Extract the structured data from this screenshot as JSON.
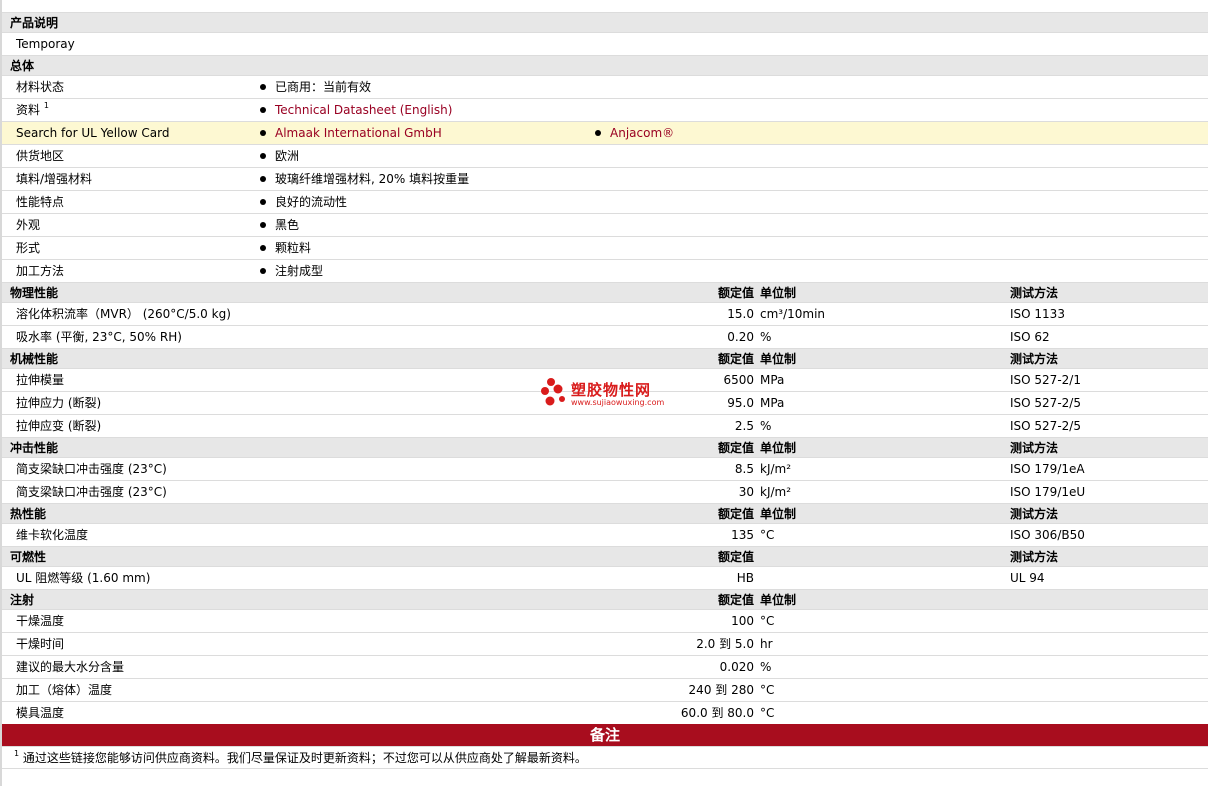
{
  "sections": [
    {
      "title": "产品说明",
      "rows": [
        {
          "label": "Temporay",
          "indent": "small"
        }
      ]
    },
    {
      "title": "总体",
      "rows": [
        {
          "label": "材料状态",
          "bullets": [
            "已商用：当前有效"
          ]
        },
        {
          "label": "资料",
          "sup": "1",
          "bullets": [
            "Technical Datasheet (English)"
          ],
          "link": true
        },
        {
          "label": "Search for UL Yellow Card",
          "bullets": [
            "Almaak International GmbH",
            "Anjacom®"
          ],
          "link": true,
          "highlight": true
        },
        {
          "label": "供货地区",
          "bullets": [
            "欧洲"
          ]
        },
        {
          "label": "填料/增强材料",
          "bullets": [
            "玻璃纤维增强材料, 20% 填料按重量"
          ]
        },
        {
          "label": "性能特点",
          "bullets": [
            "良好的流动性"
          ]
        },
        {
          "label": "外观",
          "bullets": [
            "黑色"
          ]
        },
        {
          "label": "形式",
          "bullets": [
            "颗粒料"
          ]
        },
        {
          "label": "加工方法",
          "bullets": [
            "注射成型"
          ]
        }
      ]
    },
    {
      "title": "物理性能",
      "h_value": "额定值",
      "h_unit": "单位制",
      "h_method": "测试方法",
      "rows": [
        {
          "label": "溶化体积流率（MVR） (260°C/5.0 kg)",
          "value": "15.0",
          "unit": "cm³/10min",
          "method": "ISO 1133"
        },
        {
          "label": "吸水率 (平衡, 23°C, 50% RH)",
          "value": "0.20",
          "unit": "%",
          "method": "ISO 62"
        }
      ]
    },
    {
      "title": "机械性能",
      "h_value": "额定值",
      "h_unit": "单位制",
      "h_method": "测试方法",
      "rows": [
        {
          "label": "拉伸模量",
          "value": "6500",
          "unit": "MPa",
          "method": "ISO 527-2/1"
        },
        {
          "label": "拉伸应力 (断裂)",
          "value": "95.0",
          "unit": "MPa",
          "method": "ISO 527-2/5"
        },
        {
          "label": "拉伸应变 (断裂)",
          "value": "2.5",
          "unit": "%",
          "method": "ISO 527-2/5"
        }
      ]
    },
    {
      "title": "冲击性能",
      "h_value": "额定值",
      "h_unit": "单位制",
      "h_method": "测试方法",
      "rows": [
        {
          "label": "简支梁缺口冲击强度 (23°C)",
          "value": "8.5",
          "unit": "kJ/m²",
          "method": "ISO 179/1eA"
        },
        {
          "label": "简支梁缺口冲击强度 (23°C)",
          "value": "30",
          "unit": "kJ/m²",
          "method": "ISO 179/1eU"
        }
      ]
    },
    {
      "title": "热性能",
      "h_value": "额定值",
      "h_unit": "单位制",
      "h_method": "测试方法",
      "rows": [
        {
          "label": "维卡软化温度",
          "value": "135",
          "unit": "°C",
          "method": "ISO 306/B50"
        }
      ]
    },
    {
      "title": "可燃性",
      "h_value": "额定值",
      "h_method": "测试方法",
      "rows": [
        {
          "label": "UL 阻燃等级 (1.60 mm)",
          "value": "HB",
          "method": "UL 94"
        }
      ]
    },
    {
      "title": "注射",
      "h_value": "额定值",
      "h_unit": "单位制",
      "rows": [
        {
          "label": "干燥温度",
          "value": "100",
          "unit": "°C"
        },
        {
          "label": "干燥时间",
          "value": "2.0 到  5.0",
          "unit": "hr"
        },
        {
          "label": "建议的最大水分含量",
          "value": "0.020",
          "unit": "%"
        },
        {
          "label": "加工（熔体）温度",
          "value": "240 到  280",
          "unit": "°C"
        },
        {
          "label": "模具温度",
          "value": "60.0 到  80.0",
          "unit": "°C"
        }
      ]
    }
  ],
  "notes": {
    "title": "备注",
    "footnote_mark": "1",
    "footnote_text": "通过这些链接您能够访问供应商资料。我们尽量保证及时更新资料；不过您可以从供应商处了解最新资料。"
  },
  "watermark": {
    "name": "塑胶物性网",
    "url": "www.sujiaowuxing.com"
  },
  "colors": {
    "notes_bar": "#a80d1e",
    "link": "#990022",
    "highlight_row": "#fdf8d2",
    "section_bg": "#e7e7e7"
  }
}
